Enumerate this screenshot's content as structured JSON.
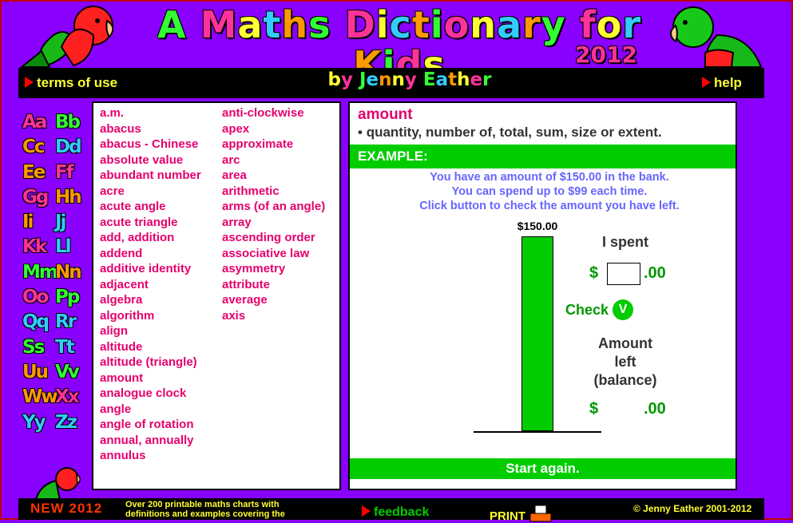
{
  "header": {
    "title": "A Maths Dictionary for Kids",
    "year": "2012",
    "byline": "by Jenny Eather",
    "terms_label": "terms of use",
    "help_label": "help"
  },
  "alphabet": [
    {
      "label": "Aa",
      "color": "#ff3399"
    },
    {
      "label": "Bb",
      "color": "#33ff33"
    },
    {
      "label": "Cc",
      "color": "#ff9900"
    },
    {
      "label": "Dd",
      "color": "#33ccff"
    },
    {
      "label": "Ee",
      "color": "#ff9900"
    },
    {
      "label": "Ff",
      "color": "#ff3399"
    },
    {
      "label": "Gg",
      "color": "#ff3399"
    },
    {
      "label": "Hh",
      "color": "#ff9900"
    },
    {
      "label": "Ii",
      "color": "#ff9900"
    },
    {
      "label": "Jj",
      "color": "#33ccff"
    },
    {
      "label": "Kk",
      "color": "#ff3399"
    },
    {
      "label": "Ll",
      "color": "#33ccff"
    },
    {
      "label": "Mm",
      "color": "#33ff33"
    },
    {
      "label": "Nn",
      "color": "#ff9900"
    },
    {
      "label": "Oo",
      "color": "#ff3399"
    },
    {
      "label": "Pp",
      "color": "#33ff33"
    },
    {
      "label": "Qq",
      "color": "#33ccff"
    },
    {
      "label": "Rr",
      "color": "#33ccff"
    },
    {
      "label": "Ss",
      "color": "#33ff33"
    },
    {
      "label": "Tt",
      "color": "#33ccff"
    },
    {
      "label": "Uu",
      "color": "#ff9900"
    },
    {
      "label": "Vv",
      "color": "#33ff33"
    },
    {
      "label": "Ww",
      "color": "#ff9900"
    },
    {
      "label": "Xx",
      "color": "#ff3399"
    },
    {
      "label": "Yy",
      "color": "#33ccff"
    },
    {
      "label": "Zz",
      "color": "#33ccff"
    }
  ],
  "words": {
    "column1": [
      "a.m.",
      "abacus",
      "abacus -  Chinese",
      "absolute value",
      "abundant number",
      "acre",
      "acute angle",
      "acute triangle",
      "add, addition",
      "addend",
      "additive identity",
      "adjacent",
      "algebra",
      "algorithm",
      "align",
      "altitude",
      "altitude (triangle)",
      "amount",
      "analogue clock",
      "angle",
      "angle of rotation",
      "annual, annually",
      "annulus"
    ],
    "column2": [
      "anti-clockwise",
      "apex",
      "approximate",
      "arc",
      "area",
      "arithmetic",
      "arms (of an angle)",
      "array",
      "ascending order",
      "associative law",
      "asymmetry",
      "attribute",
      "average",
      "axis"
    ]
  },
  "entry": {
    "term": "amount",
    "definition": "quantity, number of, total, sum, size or extent.",
    "example_label": "EXAMPLE:",
    "instructions": [
      "You have an amount of $150.00 in the bank.",
      "You can spend up to $99 each time.",
      "Click button to check the amount you have left."
    ],
    "bar_value_label": "$150.00",
    "bar_fill_fraction": 1.0,
    "spent_label": "I spent",
    "dollar_sign": "$",
    "cents_suffix": ".00",
    "spent_input_value": "",
    "check_label": "Check",
    "check_icon": "V",
    "left_label_lines": [
      "Amount",
      "left",
      "(balance)"
    ],
    "start_again_label": "Start again."
  },
  "footer": {
    "new_label": "NEW 2012",
    "promo_text": "Over 200 printable maths charts with definitions and examples covering the",
    "feedback_label": "feedback",
    "print_label": "PRINT",
    "copyright": "© Jenny Eather 2001-2012"
  },
  "colors": {
    "background": "#8a00ff",
    "accent_green": "#00cc00",
    "term_pink": "#e6006e",
    "nav_yellow": "#ffff33"
  }
}
